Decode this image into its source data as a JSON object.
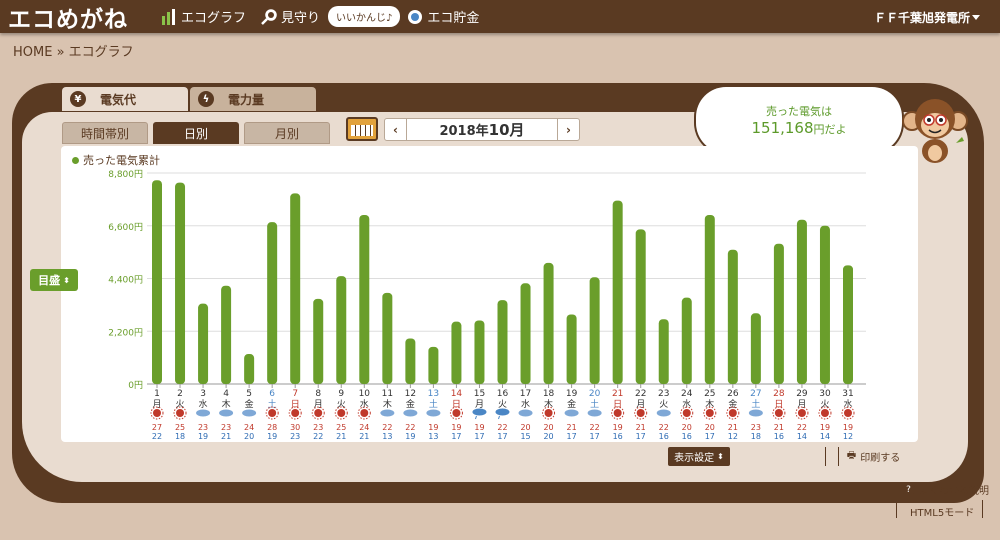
{
  "header": {
    "logo": "エコめがね",
    "nav": [
      {
        "label": "エコグラフ",
        "icon": "bar-chart-icon"
      },
      {
        "label": "見守り",
        "icon": "magnifier-icon"
      },
      {
        "label": "エコ貯金",
        "icon": "piggy-bank-icon"
      }
    ],
    "bubble": "いいかんじ♪",
    "station": "ＦＦ千葉旭発電所"
  },
  "breadcrumb": "HOME » エコグラフ",
  "tabs": {
    "active": {
      "label": "電気代",
      "icon": "yen-icon"
    },
    "inactive": {
      "label": "電力量",
      "icon": "lightning-icon"
    }
  },
  "period_tabs": [
    "時間帯別",
    "日別",
    "月別"
  ],
  "month_nav": {
    "prev": "‹",
    "next": "›",
    "year": "2018年",
    "month": "10月"
  },
  "sold": {
    "label": "売った電気は",
    "amount": "151,168",
    "suffix": "円だよ"
  },
  "memori_label": "目盛",
  "legend": "売った電気累計",
  "display_settings": "表示設定",
  "print": "印刷する",
  "help": "よくわかる説明",
  "html5": "HTML5モード",
  "colors": {
    "bar": "#6a9e2b",
    "brown": "#5a3a22",
    "saturday": "#4a86c5",
    "sunday": "#c0392b",
    "high": "#c0392b",
    "low": "#2e6bb3"
  },
  "chart_data": {
    "type": "bar",
    "ylim": [
      0,
      8800
    ],
    "yticks": [
      "0円",
      "2,200円",
      "4,400円",
      "6,600円",
      "8,800円"
    ],
    "categories": [
      "1",
      "2",
      "3",
      "4",
      "5",
      "6",
      "7",
      "8",
      "9",
      "10",
      "11",
      "12",
      "13",
      "14",
      "15",
      "16",
      "17",
      "18",
      "19",
      "20",
      "21",
      "22",
      "23",
      "24",
      "25",
      "26",
      "27",
      "28",
      "29",
      "30",
      "31"
    ],
    "weekdays": [
      "月",
      "火",
      "水",
      "木",
      "金",
      "土",
      "日",
      "月",
      "火",
      "水",
      "木",
      "金",
      "土",
      "日",
      "月",
      "火",
      "水",
      "木",
      "金",
      "土",
      "日",
      "月",
      "火",
      "水",
      "木",
      "金",
      "土",
      "日",
      "月",
      "火",
      "水"
    ],
    "values": [
      8500,
      8400,
      3350,
      4100,
      1250,
      6750,
      7950,
      3550,
      4500,
      7050,
      3800,
      1900,
      1550,
      2600,
      2650,
      3500,
      4200,
      5050,
      2900,
      4450,
      7650,
      6450,
      2700,
      3600,
      7050,
      5600,
      2950,
      5850,
      6850,
      6600,
      4950
    ],
    "weather": [
      "sun",
      "sun",
      "cloud",
      "cloud",
      "cloud",
      "sun",
      "sun",
      "sun",
      "sun",
      "sun",
      "cloud",
      "cloud",
      "cloud",
      "sun",
      "rain",
      "rain",
      "cloud",
      "sun",
      "cloud",
      "cloud",
      "sun",
      "sun",
      "cloud",
      "sun",
      "sun",
      "sun",
      "cloud",
      "sun",
      "sun",
      "sun",
      "sun"
    ],
    "high": [
      "27",
      "25",
      "23",
      "23",
      "24",
      "28",
      "30",
      "23",
      "25",
      "24",
      "22",
      "22",
      "19",
      "19",
      "19",
      "22",
      "20",
      "20",
      "21",
      "22",
      "19",
      "21",
      "22",
      "20",
      "20",
      "21",
      "23",
      "21",
      "22",
      "19",
      "19"
    ],
    "low": [
      "22",
      "18",
      "19",
      "21",
      "20",
      "19",
      "23",
      "22",
      "21",
      "21",
      "13",
      "19",
      "13",
      "17",
      "17",
      "17",
      "15",
      "20",
      "17",
      "17",
      "16",
      "17",
      "16",
      "16",
      "17",
      "12",
      "18",
      "16",
      "14",
      "14",
      "12"
    ]
  }
}
